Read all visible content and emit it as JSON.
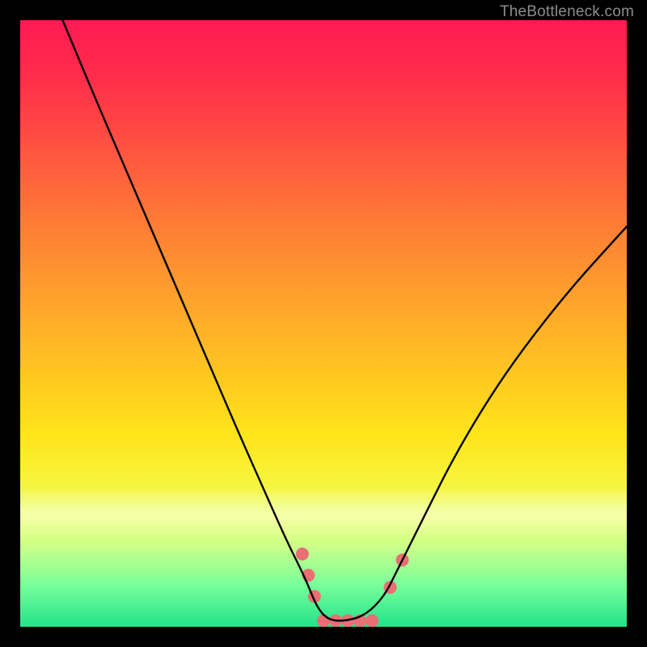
{
  "watermark": "TheBottleneck.com",
  "chart_data": {
    "type": "line",
    "title": "",
    "xlabel": "",
    "ylabel": "",
    "xlim": [
      0,
      100
    ],
    "ylim": [
      0,
      100
    ],
    "grid": false,
    "legend": false,
    "background_gradient": {
      "direction": "vertical",
      "stops": [
        {
          "pos": 0.0,
          "color": "#ff1a52"
        },
        {
          "pos": 0.1,
          "color": "#ff2e4a"
        },
        {
          "pos": 0.22,
          "color": "#ff5640"
        },
        {
          "pos": 0.33,
          "color": "#ff7a36"
        },
        {
          "pos": 0.46,
          "color": "#ffa22c"
        },
        {
          "pos": 0.57,
          "color": "#ffc322"
        },
        {
          "pos": 0.68,
          "color": "#ffe41a"
        },
        {
          "pos": 0.76,
          "color": "#f7f43a"
        },
        {
          "pos": 0.82,
          "color": "#e8ff6a"
        },
        {
          "pos": 0.87,
          "color": "#c8ff8a"
        },
        {
          "pos": 0.93,
          "color": "#7aff9a"
        },
        {
          "pos": 1.0,
          "color": "#21e38b"
        }
      ]
    },
    "series": [
      {
        "name": "curve",
        "stroke": "#000000",
        "stroke_width": 2,
        "x": [
          7,
          12,
          18,
          24,
          30,
          36,
          40,
          44,
          47,
          49,
          51,
          54,
          57,
          60,
          62,
          66,
          72,
          80,
          90,
          100
        ],
        "y": [
          100,
          88,
          74,
          60,
          46,
          32,
          23,
          14,
          8,
          3,
          1,
          1,
          2,
          5,
          9,
          17,
          29,
          42,
          55,
          66
        ]
      }
    ],
    "markers": {
      "name": "valley-markers",
      "color": "#e96f74",
      "radius": 8,
      "points": [
        {
          "x": 46.5,
          "y": 12
        },
        {
          "x": 47.5,
          "y": 8.5
        },
        {
          "x": 48.5,
          "y": 5
        },
        {
          "x": 50,
          "y": 1
        },
        {
          "x": 52,
          "y": 1
        },
        {
          "x": 54,
          "y": 1
        },
        {
          "x": 56,
          "y": 1
        },
        {
          "x": 58,
          "y": 1
        },
        {
          "x": 61,
          "y": 6.5
        },
        {
          "x": 63,
          "y": 11
        }
      ]
    }
  }
}
